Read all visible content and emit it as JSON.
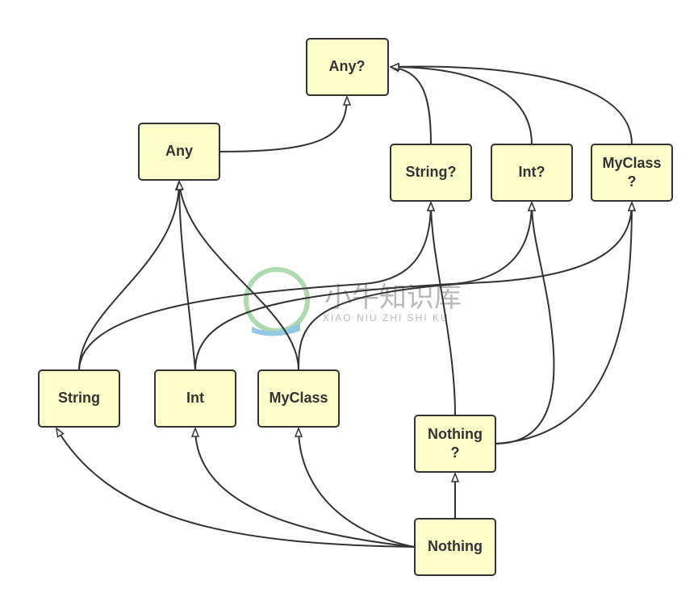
{
  "diagram": {
    "nodes": {
      "any_nullable": "Any?",
      "any": "Any",
      "string_nullable": "String?",
      "int_nullable": "Int?",
      "myclass_nullable_line1": "MyClass",
      "myclass_nullable_line2": "?",
      "string": "String",
      "int": "Int",
      "myclass": "MyClass",
      "nothing_nullable_line1": "Nothing",
      "nothing_nullable_line2": "?",
      "nothing": "Nothing"
    },
    "edges": [
      [
        "Any",
        "Any?"
      ],
      [
        "String?",
        "Any?"
      ],
      [
        "Int?",
        "Any?"
      ],
      [
        "MyClass?",
        "Any?"
      ],
      [
        "String",
        "Any"
      ],
      [
        "Int",
        "Any"
      ],
      [
        "MyClass",
        "Any"
      ],
      [
        "String",
        "String?"
      ],
      [
        "Int",
        "Int?"
      ],
      [
        "MyClass",
        "MyClass?"
      ],
      [
        "Nothing?",
        "String?"
      ],
      [
        "Nothing?",
        "Int?"
      ],
      [
        "Nothing?",
        "MyClass?"
      ],
      [
        "Nothing",
        "Nothing?"
      ],
      [
        "Nothing",
        "String"
      ],
      [
        "Nothing",
        "Int"
      ],
      [
        "Nothing",
        "MyClass"
      ]
    ],
    "colors": {
      "node_fill": "#ffffcc",
      "stroke": "#333333"
    }
  },
  "watermark": {
    "cn": "小牛知识库",
    "en": "XIAO NIU ZHI SHI KU"
  }
}
